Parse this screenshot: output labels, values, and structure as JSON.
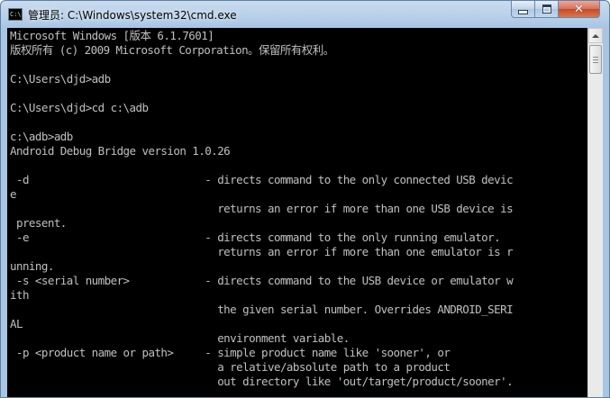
{
  "window": {
    "title": "管理员: C:\\Windows\\system32\\cmd.exe",
    "icon_name": "cmd-icon",
    "icon_glyph": "C:\\",
    "controls": {
      "minimize": "minimize-icon",
      "maximize": "maximize-icon",
      "close": "close-icon",
      "close_glyph": "✕"
    }
  },
  "console": {
    "colors": {
      "background": "#000000",
      "text": "#c0c0c0"
    },
    "lines": [
      "Microsoft Windows [版本 6.1.7601]",
      "版权所有 (c) 2009 Microsoft Corporation。保留所有权利。",
      "",
      "C:\\Users\\djd>adb",
      "",
      "C:\\Users\\djd>cd c:\\adb",
      "",
      "c:\\adb>adb",
      "Android Debug Bridge version 1.0.26",
      "",
      " -d                            - directs command to the only connected USB devic",
      "e",
      "                                 returns an error if more than one USB device is",
      " present.",
      " -e                            - directs command to the only running emulator.",
      "                                 returns an error if more than one emulator is r",
      "unning.",
      " -s <serial number>            - directs command to the USB device or emulator w",
      "ith",
      "                                 the given serial number. Overrides ANDROID_SERI",
      "AL",
      "                                 environment variable.",
      " -p <product name or path>     - simple product name like 'sooner', or",
      "                                 a relative/absolute path to a product",
      "                                 out directory like 'out/target/product/sooner'."
    ]
  },
  "scrollbar": {
    "up_arrow": "scroll-up-arrow-icon",
    "position_fraction": 0.0
  }
}
